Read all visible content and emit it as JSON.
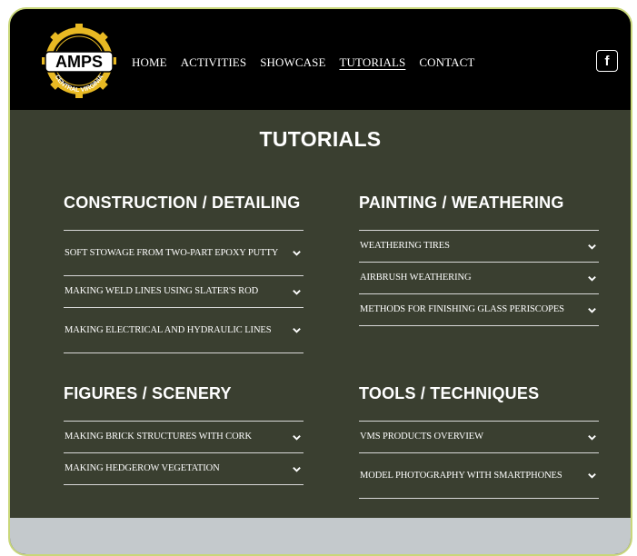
{
  "logo": {
    "main_text": "AMPS",
    "ring_text": "CENTRAL VIRGINIA"
  },
  "nav": {
    "items": [
      {
        "label": "HOME"
      },
      {
        "label": "ACTIVITIES"
      },
      {
        "label": "SHOWCASE"
      },
      {
        "label": "TUTORIALS",
        "active": true
      },
      {
        "label": "CONTACT"
      }
    ]
  },
  "social": {
    "facebook_glyph": "f"
  },
  "page": {
    "title": "TUTORIALS"
  },
  "categories": [
    {
      "title": "CONSTRUCTION / DETAILING",
      "items": [
        {
          "label": "SOFT STOWAGE FROM TWO-PART EPOXY PUTTY"
        },
        {
          "label": "MAKING WELD LINES USING SLATER'S ROD"
        },
        {
          "label": "MAKING ELECTRICAL AND HYDRAULIC LINES"
        }
      ]
    },
    {
      "title": "PAINTING / WEATHERING",
      "items": [
        {
          "label": "WEATHERING TIRES"
        },
        {
          "label": "AIRBRUSH WEATHERING"
        },
        {
          "label": "METHODS FOR FINISHING GLASS PERISCOPES"
        }
      ]
    },
    {
      "title": "FIGURES / SCENERY",
      "items": [
        {
          "label": "MAKING BRICK STRUCTURES WITH CORK"
        },
        {
          "label": "MAKING HEDGEROW VEGETATION"
        }
      ]
    },
    {
      "title": "TOOLS / TECHNIQUES",
      "items": [
        {
          "label": "VMS PRODUCTS OVERVIEW"
        },
        {
          "label": "MODEL PHOTOGRAPHY WITH SMARTPHONES"
        }
      ]
    }
  ],
  "colors": {
    "header_bg": "#000000",
    "content_bg": "#3a3f30",
    "footer_bg": "#c4c9cc",
    "frame_border": "#c9d77a",
    "logo_gold": "#e8b923"
  },
  "icons": {
    "accordion_toggle": "chevron-down-icon",
    "social": "facebook-icon"
  }
}
